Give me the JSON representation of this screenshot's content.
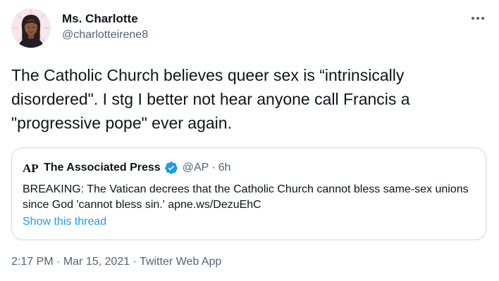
{
  "author": {
    "display_name": "Ms. Charlotte",
    "handle": "@charlotteirene8"
  },
  "tweet": {
    "text": "The Catholic Church believes queer sex is “intrinsically disordered\". I stg I better not hear anyone call Francis a \"progressive pope\" ever again."
  },
  "quoted_tweet": {
    "logo_text": "AP",
    "display_name": "The Associated Press",
    "handle": "@AP",
    "separator": "·",
    "time": "6h",
    "text": "BREAKING: The Vatican decrees that the Catholic Church cannot bless same-sex unions since God 'cannot bless sin.' apne.ws/DezuEhC",
    "show_thread": "Show this thread",
    "verified": true
  },
  "meta": {
    "time": "2:17 PM",
    "separator": "·",
    "date": "Mar 15, 2021",
    "source": "Twitter Web App"
  },
  "colors": {
    "link": "#1d9bf0",
    "secondary_text": "#536471",
    "border": "#cfd9de",
    "ap_red": "#e10b1f"
  }
}
